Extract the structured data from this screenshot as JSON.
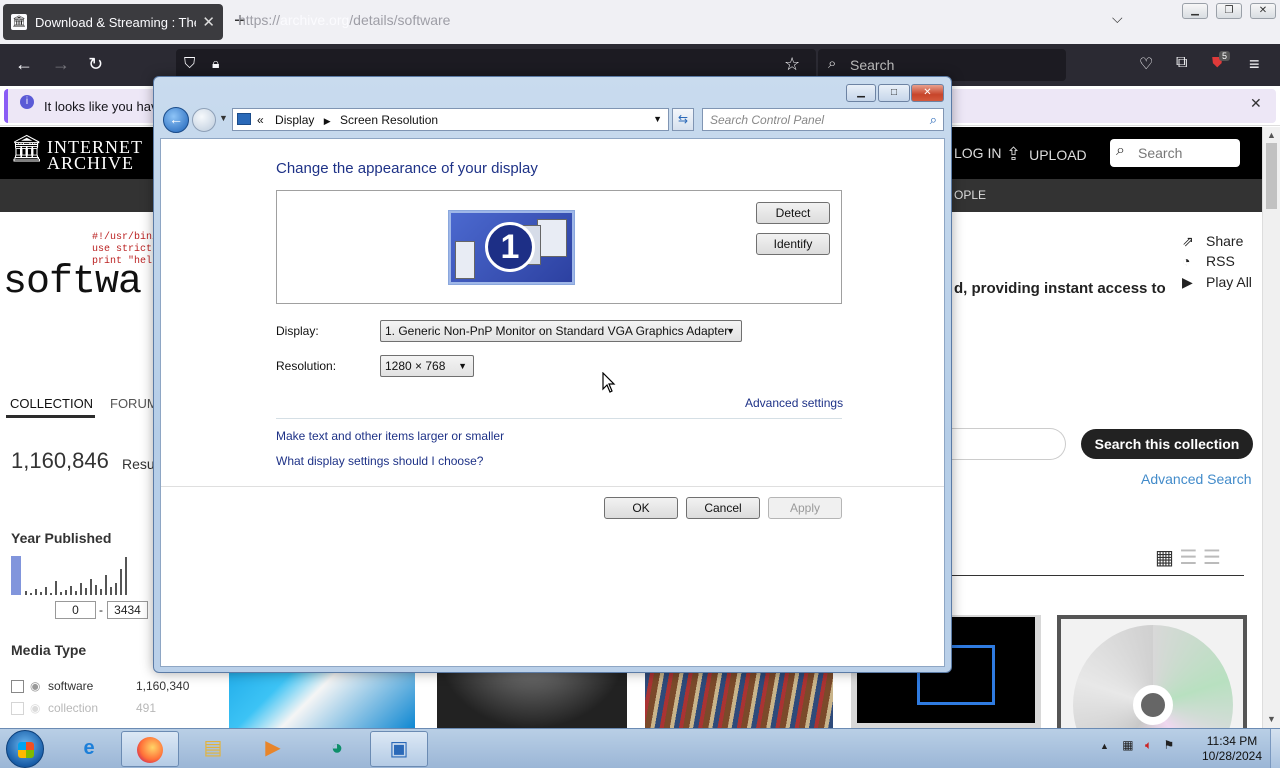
{
  "browser": {
    "tab_title": "Download & Streaming : The Internet Archive",
    "new_tab": "+",
    "url_prefix": "https://",
    "url_domain": "archive.org",
    "url_path": "/details/software",
    "search_placeholder": "Search",
    "notification_text": "It looks like you have",
    "extension_badge": "5"
  },
  "archive": {
    "logo_line1": "INTERNET",
    "logo_line2": "ARCHIVE",
    "login": "LOG IN",
    "upload": "UPLOAD",
    "search_placeholder": "Search",
    "subnav_people": "OPLE",
    "code_lines": [
      "#!/usr/bin/p",
      "use strict;",
      "print \"hello w"
    ],
    "collection_title": "softwa",
    "description": "d, providing instant access to",
    "share": "Share",
    "rss": "RSS",
    "play_all": "Play All",
    "tab_collection": "COLLECTION",
    "tab_forum": "FORUM",
    "result_count": "1,160,846",
    "results_label": "Resu",
    "search_collection_button": "Search this collection",
    "advanced_search": "Advanced Search",
    "year_published": "Year Published",
    "year_from": "0",
    "year_to": "3434",
    "year_dash": "-",
    "media_type": "Media Type",
    "facets": [
      {
        "label": "software",
        "count": "1,160,340"
      },
      {
        "label": "collection",
        "count": "491"
      }
    ]
  },
  "dialog": {
    "breadcrumb_sep": "«",
    "breadcrumb": [
      "Display",
      "Screen Resolution"
    ],
    "search_placeholder": "Search Control Panel",
    "heading": "Change the appearance of your display",
    "monitor_number": "1",
    "detect": "Detect",
    "identify": "Identify",
    "display_label": "Display:",
    "display_value": "1. Generic Non-PnP Monitor on Standard VGA Graphics Adapter",
    "resolution_label": "Resolution:",
    "resolution_value": "1280 × 768",
    "advanced_settings": "Advanced settings",
    "link_text_size": "Make text and other items larger or smaller",
    "link_which_settings": "What display settings should I choose?",
    "ok": "OK",
    "cancel": "Cancel",
    "apply": "Apply"
  },
  "taskbar": {
    "time": "11:34 PM",
    "date": "10/28/2024"
  }
}
